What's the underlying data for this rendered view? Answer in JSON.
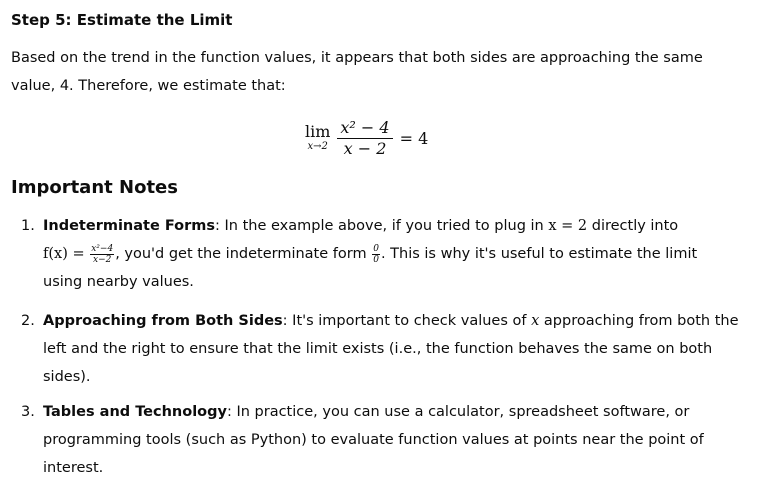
{
  "step": {
    "heading": "Step 5: Estimate the Limit",
    "paragraph": "Based on the trend in the function values, it appears that both sides are approaching the same value, 4. Therefore, we estimate that:",
    "formula": {
      "lim": "lim",
      "sub": "x→2",
      "numerator": "x² − 4",
      "denominator": "x − 2",
      "rhs": "= 4"
    }
  },
  "notes": {
    "heading": "Important Notes",
    "items": [
      {
        "num": "1.",
        "title": "Indeterminate Forms",
        "text_a": ": In the example above, if you tried to plug in ",
        "math_a": "x = 2",
        "text_b": " directly into",
        "math_f": "f(x) = ",
        "frac_n": "x²−4",
        "frac_d": "x−2",
        "text_c": ", you'd get the indeterminate form ",
        "frac0_n": "0",
        "frac0_d": "0",
        "text_d": ". This is why it's useful to estimate the limit",
        "text_e": "using nearby values."
      },
      {
        "num": "2.",
        "title": "Approaching from Both Sides",
        "text_a": ": It's important to check values of ",
        "math_a": "x",
        "text_b": " approaching from both the",
        "line2": "left and the right to ensure that the limit exists (i.e., the function behaves the same on both",
        "line3": "sides)."
      },
      {
        "num": "3.",
        "title": "Tables and Technology",
        "text_a": ": In practice, you can use a calculator, spreadsheet software, or",
        "line2": "programming tools (such as Python) to evaluate function values at points near the point of",
        "line3": "interest."
      }
    ]
  }
}
